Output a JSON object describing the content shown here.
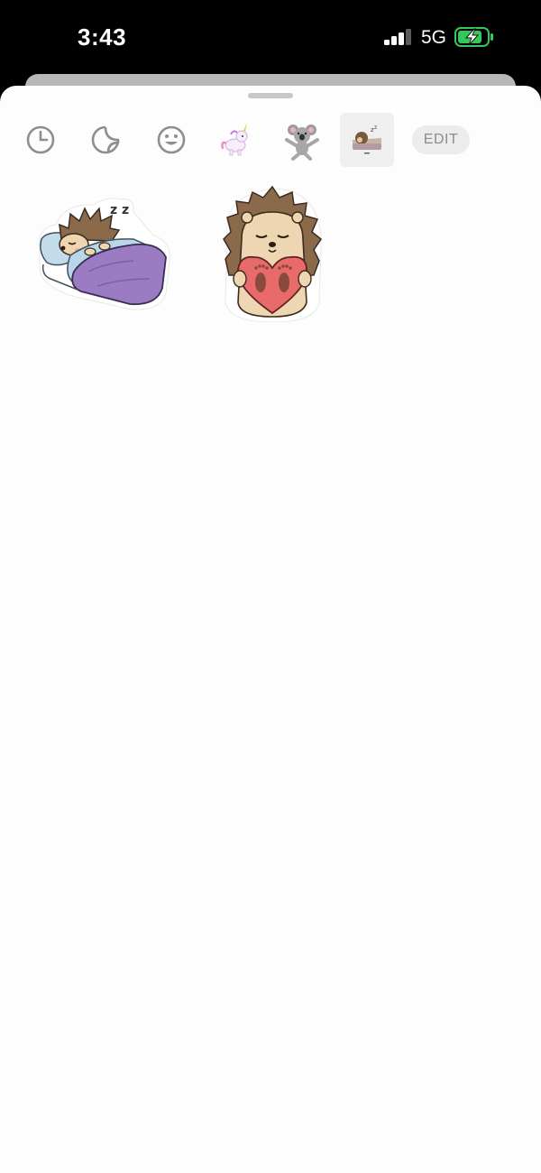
{
  "status_bar": {
    "time": "3:43",
    "network": "5G",
    "battery_state": "charging",
    "battery_color": "#35c759"
  },
  "tabs": [
    {
      "name": "recent",
      "icon": "clock-icon"
    },
    {
      "name": "stickers",
      "icon": "sticker-peel-icon"
    },
    {
      "name": "emoji",
      "icon": "smiley-face-icon"
    },
    {
      "name": "unicorn-pack",
      "icon": "unicorn-sticker-icon"
    },
    {
      "name": "koala-pack",
      "icon": "koala-sticker-icon"
    },
    {
      "name": "hedgehog-pack",
      "icon": "hedgehog-sticker-icon",
      "selected": true
    }
  ],
  "edit_label": "EDIT",
  "stickers": [
    {
      "name": "sleeping-hedgehog",
      "text": "z z"
    },
    {
      "name": "hedgehog-heart"
    }
  ],
  "colors": {
    "sheet_bg": "#fdfdfd",
    "tab_icon": "#8e8e8e",
    "selected_tab_bg": "#efefef",
    "blanket": "#9b7cc2",
    "heart": "#e86a6a"
  }
}
